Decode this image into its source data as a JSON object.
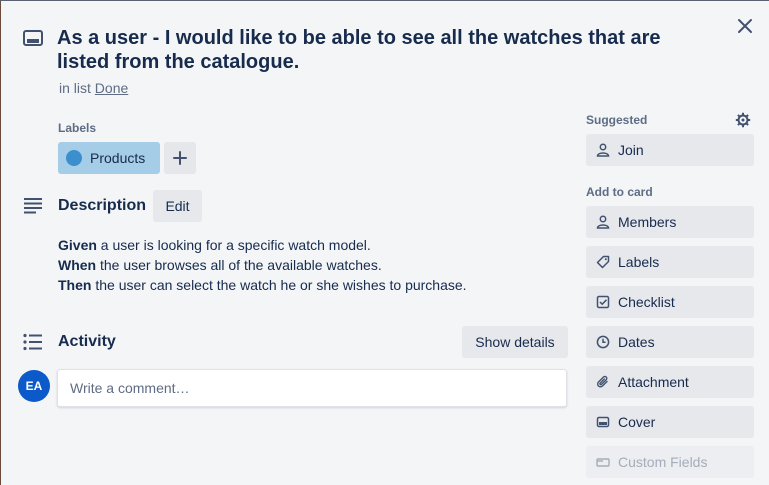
{
  "card": {
    "title": "As a user - I would like to be able to see all the watches that are listed from the catalogue.",
    "in_list_prefix": "in list",
    "list_name": "Done"
  },
  "labels": {
    "heading": "Labels",
    "items": [
      {
        "name": "Products",
        "color": "#3a8fcc",
        "bg": "#a5cde7"
      }
    ],
    "add_icon": "plus-icon"
  },
  "description": {
    "heading": "Description",
    "edit_label": "Edit",
    "lines": [
      {
        "keyword": "Given",
        "text": " a user is looking for a specific watch model."
      },
      {
        "keyword": "When",
        "text": " the user browses all of the available watches."
      },
      {
        "keyword": "Then",
        "text": " the user can select the watch he or she wishes to purchase."
      }
    ]
  },
  "activity": {
    "heading": "Activity",
    "show_details_label": "Show details",
    "avatar_initials": "EA",
    "comment_placeholder": "Write a comment…"
  },
  "sidebar": {
    "suggested_heading": "Suggested",
    "suggested": [
      {
        "label": "Join",
        "icon": "person-icon"
      }
    ],
    "add_heading": "Add to card",
    "add_items": [
      {
        "label": "Members",
        "icon": "person-icon"
      },
      {
        "label": "Labels",
        "icon": "tag-icon"
      },
      {
        "label": "Checklist",
        "icon": "checklist-icon"
      },
      {
        "label": "Dates",
        "icon": "clock-icon"
      },
      {
        "label": "Attachment",
        "icon": "paperclip-icon"
      },
      {
        "label": "Cover",
        "icon": "cover-icon"
      },
      {
        "label": "Custom Fields",
        "icon": "custom-fields-icon",
        "disabled": true
      }
    ]
  },
  "colors": {
    "accent": "#0c59c9",
    "text": "#172b4d",
    "muted": "#5e6c84",
    "button_bg": "#e6e8ec"
  }
}
